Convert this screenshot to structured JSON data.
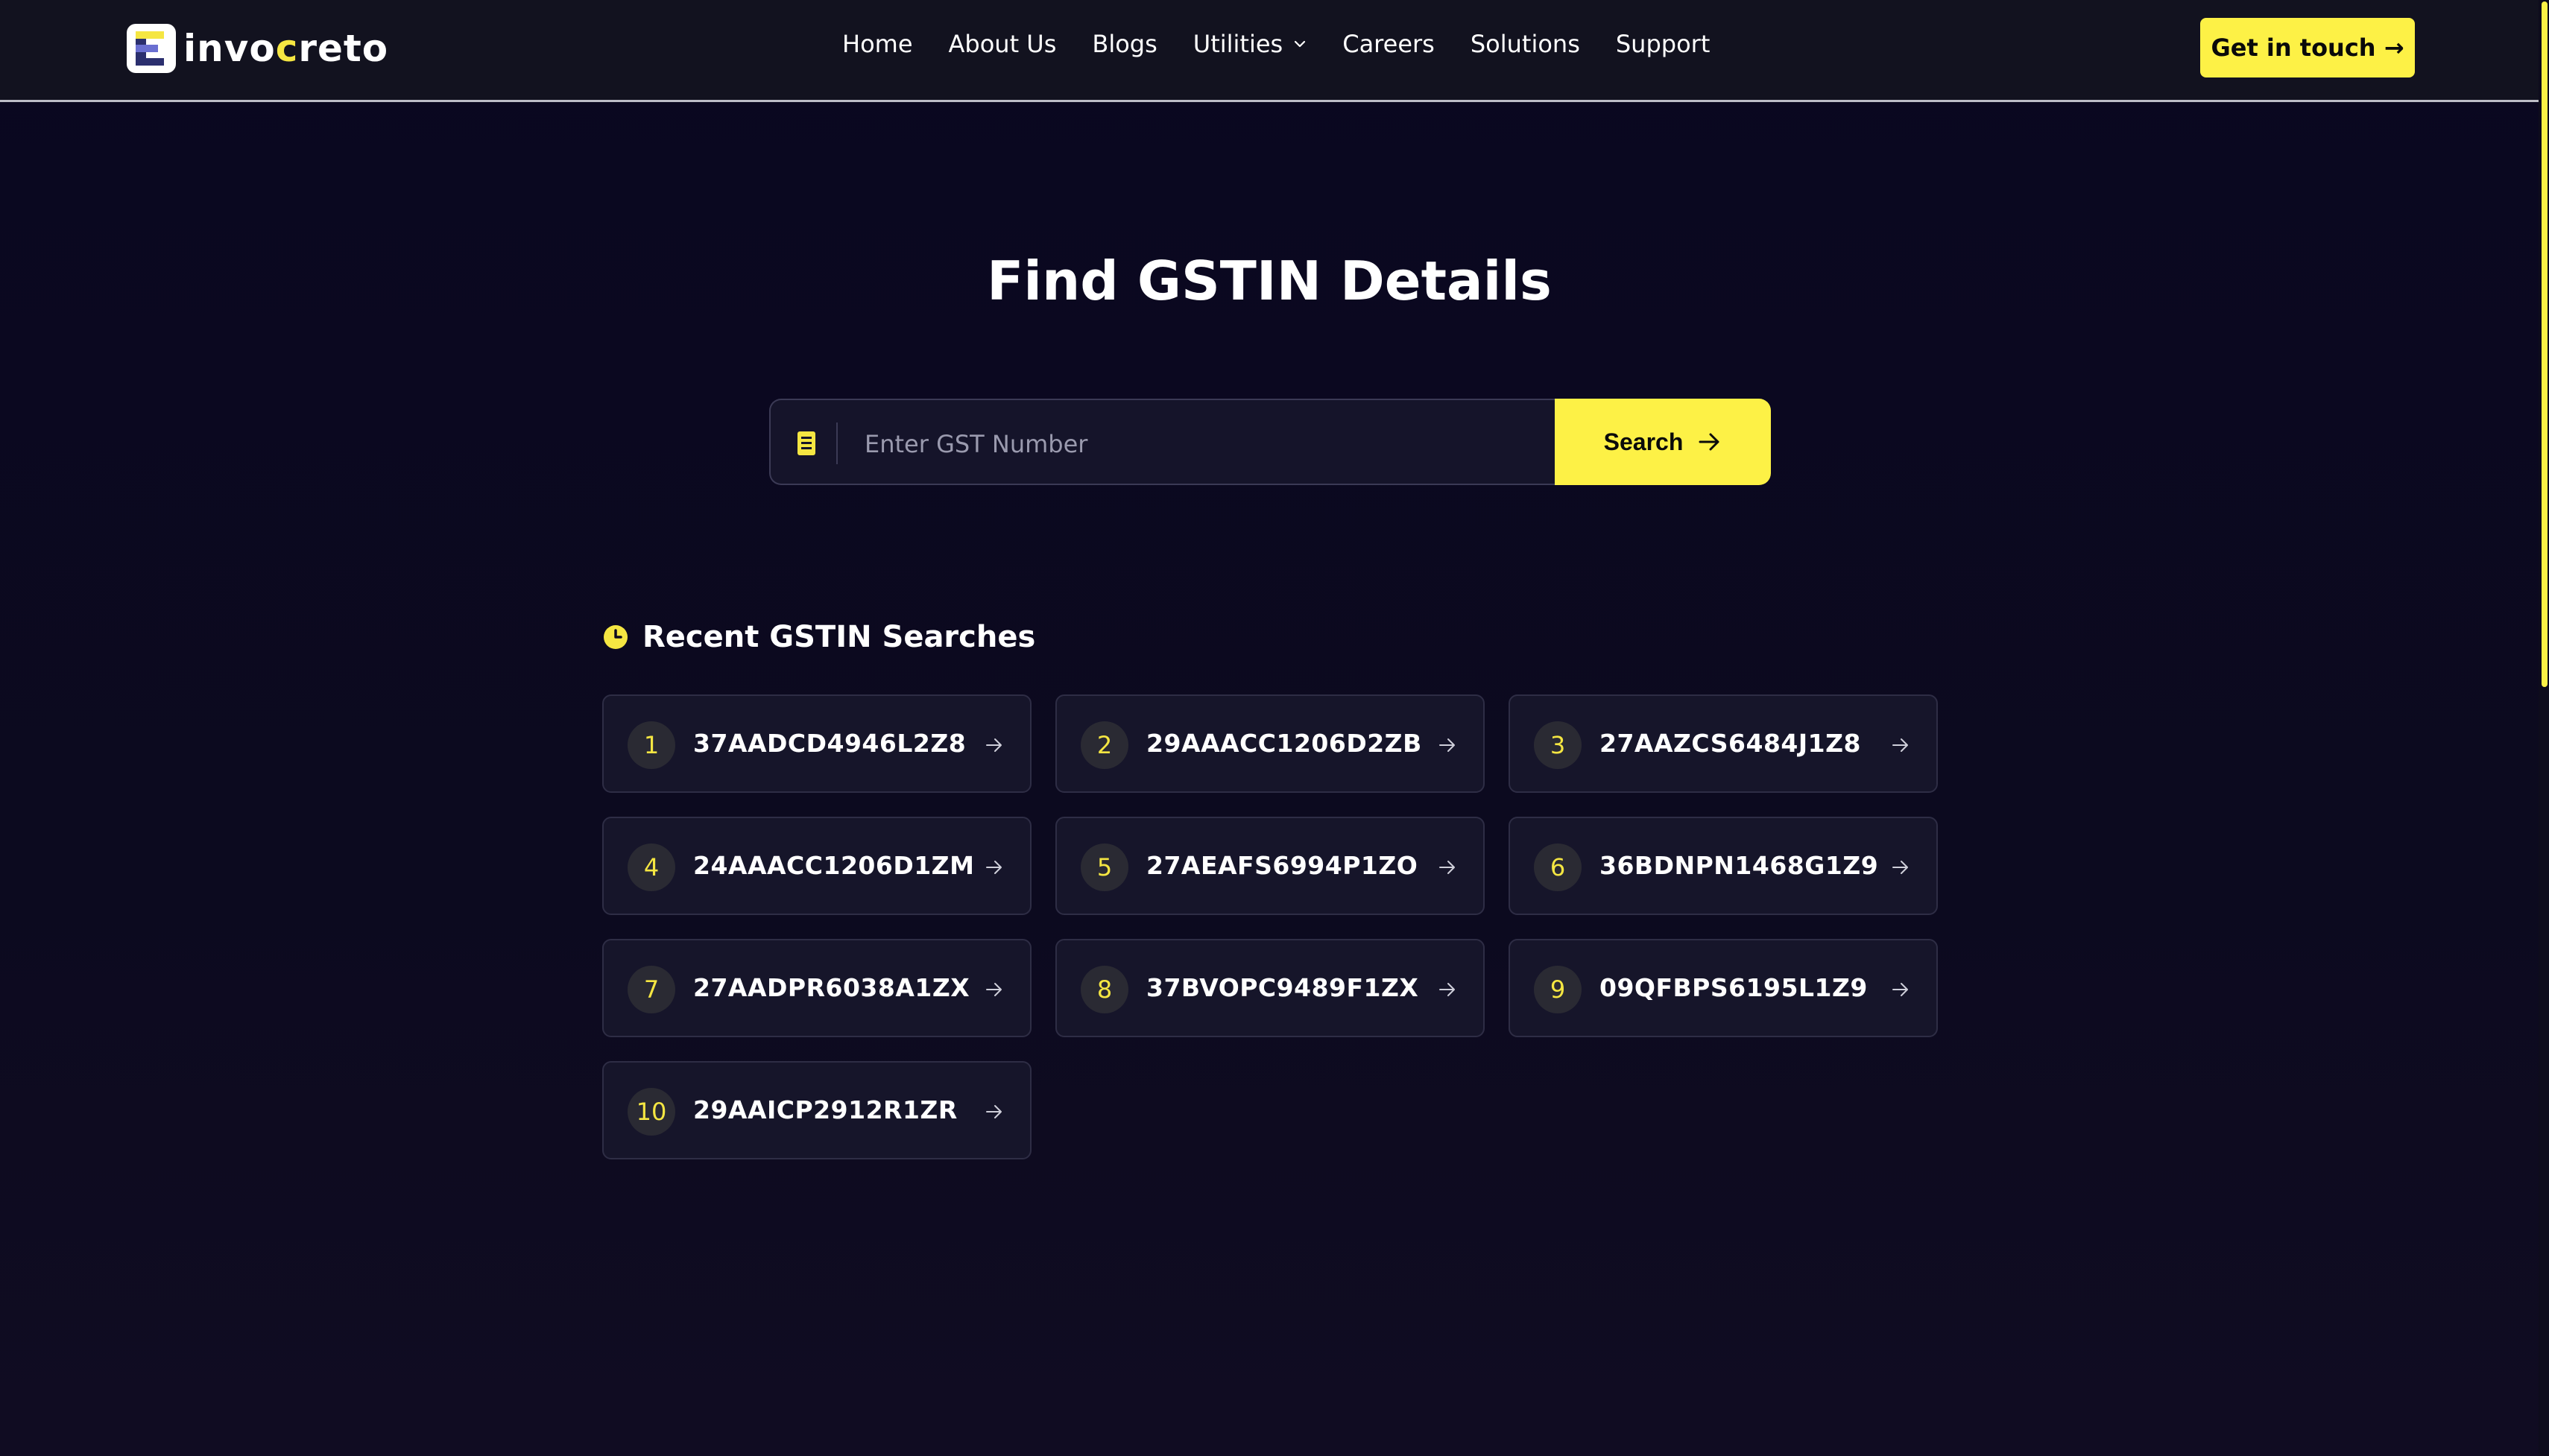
{
  "nav": {
    "logo": {
      "prefix": "invo",
      "accent": "c",
      "suffix": "reto"
    },
    "links": [
      {
        "label": "Home"
      },
      {
        "label": "About Us"
      },
      {
        "label": "Blogs"
      },
      {
        "label": "Utilities",
        "has_dropdown": true
      },
      {
        "label": "Careers"
      },
      {
        "label": "Solutions"
      },
      {
        "label": "Support"
      }
    ],
    "cta_label": "Get in touch →"
  },
  "hero": {
    "title": "Find GSTIN Details"
  },
  "search": {
    "placeholder": "Enter GST Number",
    "button_label": "Search"
  },
  "recent": {
    "title": "Recent GSTIN Searches",
    "items": [
      {
        "num": "1",
        "gstin": "37AADCD4946L2Z8"
      },
      {
        "num": "2",
        "gstin": "29AAACC1206D2ZB"
      },
      {
        "num": "3",
        "gstin": "27AAZCS6484J1Z8"
      },
      {
        "num": "4",
        "gstin": "24AAACC1206D1ZM"
      },
      {
        "num": "5",
        "gstin": "27AEAFS6994P1ZO"
      },
      {
        "num": "6",
        "gstin": "36BDNPN1468G1Z9"
      },
      {
        "num": "7",
        "gstin": "27AADPR6038A1ZX"
      },
      {
        "num": "8",
        "gstin": "37BVOPC9489F1ZX"
      },
      {
        "num": "9",
        "gstin": "09QFBPS6195L1Z9"
      },
      {
        "num": "10",
        "gstin": "29AAICP2912R1ZR"
      }
    ]
  },
  "colors": {
    "accent": "#fdf146",
    "background": "#0a0720",
    "card": "#16152a"
  },
  "icons": {
    "search_field": "document-icon",
    "recent": "clock-icon",
    "card": "arrow-right-icon"
  }
}
